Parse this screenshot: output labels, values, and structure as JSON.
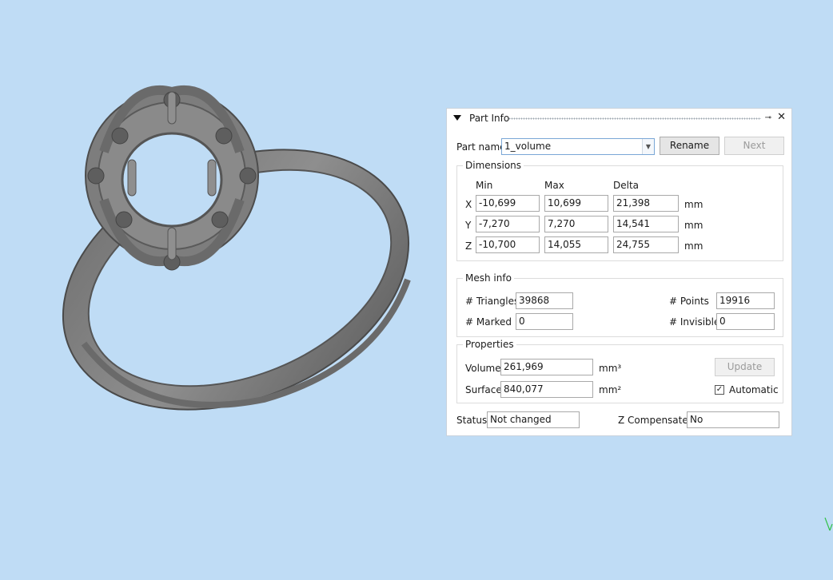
{
  "panel": {
    "title": "Part Info",
    "part_name_label": "Part name",
    "part_name_value": "1_volume",
    "rename_label": "Rename",
    "next_label": "Next",
    "dimensions": {
      "group_title": "Dimensions",
      "col_min": "Min",
      "col_max": "Max",
      "col_delta": "Delta",
      "unit": "mm",
      "rows": [
        {
          "axis": "X",
          "min": "-10,699",
          "max": "10,699",
          "delta": "21,398"
        },
        {
          "axis": "Y",
          "min": "-7,270",
          "max": "7,270",
          "delta": "14,541"
        },
        {
          "axis": "Z",
          "min": "-10,700",
          "max": "14,055",
          "delta": "24,755"
        }
      ]
    },
    "mesh_info": {
      "group_title": "Mesh info",
      "triangles_label": "# Triangles",
      "triangles_value": "39868",
      "points_label": "# Points",
      "points_value": "19916",
      "marked_label": "# Marked",
      "marked_value": "0",
      "invisible_label": "# Invisible",
      "invisible_value": "0"
    },
    "properties": {
      "group_title": "Properties",
      "volume_label": "Volume",
      "volume_value": "261,969",
      "volume_unit": "mm³",
      "surface_label": "Surface",
      "surface_value": "840,077",
      "surface_unit": "mm²",
      "update_label": "Update",
      "automatic_label": "Automatic",
      "automatic_checked": true
    },
    "status_label": "Status",
    "status_value": "Not changed",
    "zcomp_label": "Z Compensated",
    "zcomp_value": "No"
  },
  "icons": {
    "collapse": "collapse-triangle-icon",
    "pin": "pin-icon",
    "close": "close-icon",
    "dropdown": "chevron-down-icon"
  },
  "colors": {
    "viewport_background": "#bfdcf5",
    "model_gray": "#7d7d7d"
  }
}
